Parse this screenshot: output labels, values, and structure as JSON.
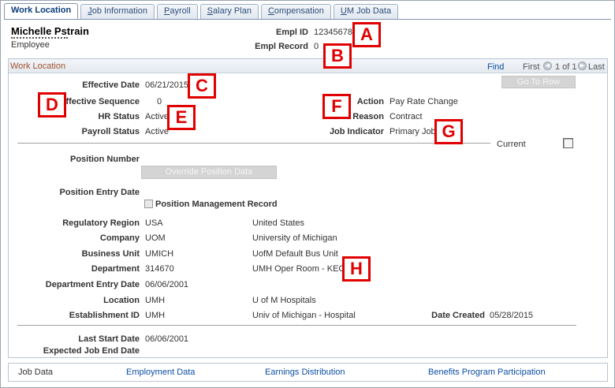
{
  "tabs": [
    {
      "label": "Work Location",
      "u": "",
      "rest": "Work Location",
      "active": true
    },
    {
      "label": "Job Information",
      "u": "J",
      "rest": "ob Information"
    },
    {
      "label": "Payroll",
      "u": "P",
      "rest": "ayroll"
    },
    {
      "label": "Salary Plan",
      "u": "S",
      "rest": "alary Plan"
    },
    {
      "label": "Compensation",
      "u": "C",
      "rest": "ompensation"
    },
    {
      "label": "UM Job Data",
      "u": "U",
      "rest": "M Job Data"
    }
  ],
  "employee": {
    "name": "Michelle Pstrain",
    "role": "Employee",
    "empl_id_label": "Empl ID",
    "empl_id": "12345678",
    "empl_record_label": "Empl Record",
    "empl_record": "0"
  },
  "section": {
    "title": "Work Location",
    "find": "Find",
    "first": "First",
    "count": "1 of 1",
    "last": "Last",
    "go_to_row": "Go To Row"
  },
  "fields": {
    "effective_date_label": "Effective Date",
    "effective_date": "06/21/2015",
    "effective_seq_label": "Effective Sequence",
    "effective_seq": "0",
    "hr_status_label": "HR Status",
    "hr_status": "Active",
    "payroll_status_label": "Payroll Status",
    "payroll_status": "Active",
    "action_label": "Action",
    "action": "Pay Rate Change",
    "reason_label": "Reason",
    "reason": "Contract",
    "job_indicator_label": "Job Indicator",
    "job_indicator": "Primary Job",
    "current_label": "Current",
    "position_number_label": "Position Number",
    "override_position": "Override Position Data",
    "position_entry_date_label": "Position Entry Date",
    "position_mgmt_record": "Position Management Record",
    "regulatory_region_label": "Regulatory Region",
    "regulatory_region": "USA",
    "regulatory_region_desc": "United States",
    "company_label": "Company",
    "company": "UOM",
    "company_desc": "University of Michigan",
    "business_unit_label": "Business Unit",
    "business_unit": "UMICH",
    "business_unit_desc": "UofM Default Bus Unit",
    "department_label": "Department",
    "department": "314670",
    "department_desc": "UMH Oper Room - KEC",
    "department_entry_label": "Department Entry Date",
    "department_entry": "06/06/2001",
    "location_label": "Location",
    "location": "UMH",
    "location_desc": "U of M Hospitals",
    "establishment_label": "Establishment ID",
    "establishment": "UMH",
    "establishment_desc": "Univ of Michigan - Hospital",
    "date_created_label": "Date Created",
    "date_created": "05/28/2015",
    "last_start_label": "Last Start Date",
    "last_start": "06/06/2001",
    "expected_end_label": "Expected Job End Date"
  },
  "markers": [
    "A",
    "B",
    "C",
    "D",
    "E",
    "F",
    "G",
    "H"
  ],
  "footer": {
    "job_data": "Job Data",
    "employment_data": "Employment Data",
    "earnings_distribution": "Earnings Distribution",
    "benefits_program": "Benefits Program Participation"
  },
  "colors": {
    "marker": "#e00000",
    "link": "#0b4fa3",
    "section_title": "#a0522d"
  }
}
